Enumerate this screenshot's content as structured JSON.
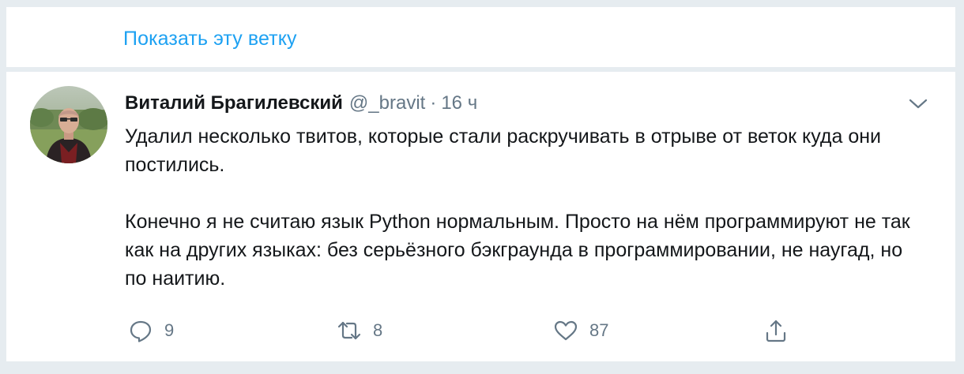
{
  "show_thread": {
    "label": "Показать эту ветку"
  },
  "tweet": {
    "author_name": "Виталий Брагилевский",
    "author_handle": "@_bravit",
    "separator": "·",
    "time": "16 ч",
    "paragraphs": [
      "Удалил несколько твитов, которые стали раскручивать в отрыве от веток куда они постились.",
      "Конечно я не считаю язык Python нормальным. Просто на нём программируют не так как на других языках: без серьёзного бэкграунда в программировании, не наугад, но по наитию."
    ],
    "actions": {
      "reply_count": "9",
      "retweet_count": "8",
      "like_count": "87"
    }
  },
  "colors": {
    "link": "#1da1f2",
    "text": "#14171a",
    "secondary": "#657786",
    "background": "#e6ecf0"
  },
  "icons": {
    "caret": "chevron-down-icon",
    "reply": "reply-icon",
    "retweet": "retweet-icon",
    "like": "heart-icon",
    "share": "share-icon"
  }
}
